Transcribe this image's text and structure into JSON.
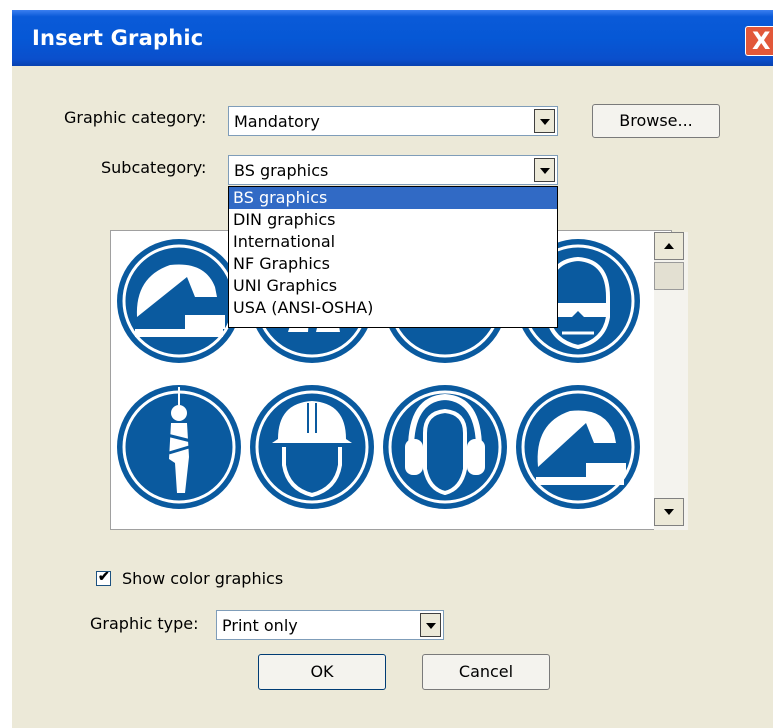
{
  "window": {
    "title": "Insert Graphic",
    "close_label": "X"
  },
  "category": {
    "label": "Graphic category:",
    "value": "Mandatory",
    "browse_label": "Browse..."
  },
  "subcategory": {
    "label": "Subcategory:",
    "value": "BS graphics",
    "options": [
      "BS graphics",
      "DIN graphics",
      "International",
      "NF Graphics",
      "UNI Graphics",
      "USA (ANSI-OSHA)"
    ],
    "selected_index": 0
  },
  "gallery": {
    "icons": [
      "face-shield-icon",
      "safety-boots-icon",
      "gauge-icon",
      "goggles-icon",
      "safety-harness-icon",
      "hard-hat-icon",
      "ear-protection-icon",
      "face-shield-icon"
    ],
    "sign_color": "#0a5a9f"
  },
  "show_color": {
    "label": "Show color graphics",
    "checked": true
  },
  "graphic_type": {
    "label": "Graphic type:",
    "value": "Print only"
  },
  "buttons": {
    "ok": "OK",
    "cancel": "Cancel"
  },
  "colors": {
    "titlebar": "#0658d6",
    "selection": "#316ac5",
    "dialog_bg": "#ece9d8"
  }
}
